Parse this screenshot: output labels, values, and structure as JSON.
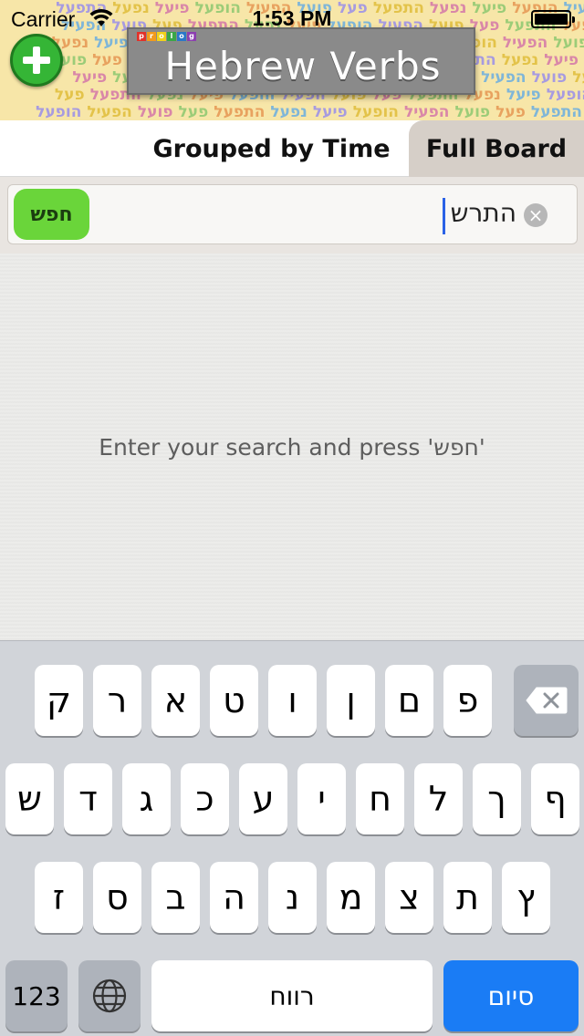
{
  "status": {
    "carrier": "Carrier",
    "time": "1:53 PM"
  },
  "header": {
    "brand_letters": [
      "p",
      "r",
      "o",
      "l",
      "o",
      "g"
    ],
    "title": "Hebrew Verbs",
    "pattern_words": [
      "הפעיל",
      "הופעל",
      "פיעל",
      "נפעל",
      "התפעל",
      "פעל",
      "פועל"
    ]
  },
  "tabs": [
    {
      "label": "Grouped by Time"
    },
    {
      "label": "Full Board"
    }
  ],
  "search": {
    "value": "התרש",
    "button_label": "חפש"
  },
  "content": {
    "hint": "Enter your search and press 'חפש'"
  },
  "keyboard": {
    "row1": [
      "ק",
      "ר",
      "א",
      "ט",
      "ו",
      "ן",
      "ם",
      "פ"
    ],
    "row2": [
      "ש",
      "ד",
      "ג",
      "כ",
      "ע",
      "י",
      "ח",
      "ל",
      "ך",
      "ף"
    ],
    "row3": [
      "ז",
      "ס",
      "ב",
      "ה",
      "נ",
      "מ",
      "צ",
      "ת",
      "ץ"
    ],
    "numbers_label": "123",
    "space_label": "רווח",
    "done_label": "סיום"
  },
  "colors": {
    "accent_green": "#6ad53a",
    "add_button_green": "#35b536",
    "keyboard_done_blue": "#1a7cf5",
    "tab_selected": "#d6cfc8"
  }
}
